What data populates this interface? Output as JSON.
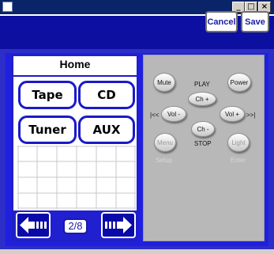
{
  "toolbar": {
    "cancel_label": "Cancel",
    "save_label": "Save"
  },
  "home": {
    "title": "Home",
    "sources": [
      "Tape",
      "CD",
      "Tuner",
      "AUX"
    ],
    "page_indicator": "2/8"
  },
  "remote": {
    "mute": "Mute",
    "power": "Power",
    "play": "PLAY",
    "ch_up": "Ch +",
    "prev": "|<<",
    "next": ">>|",
    "vol_down": "Vol -",
    "vol_up": "Vol +",
    "ch_down": "Ch -",
    "stop": "STOP",
    "menu": "Menu",
    "light": "Light",
    "setup": "Setup",
    "enter": "Enter"
  },
  "colors": {
    "primary_blue": "#1f1fe0",
    "dark_blue": "#0c0fa0",
    "panel_gray": "#b8b8b8"
  }
}
